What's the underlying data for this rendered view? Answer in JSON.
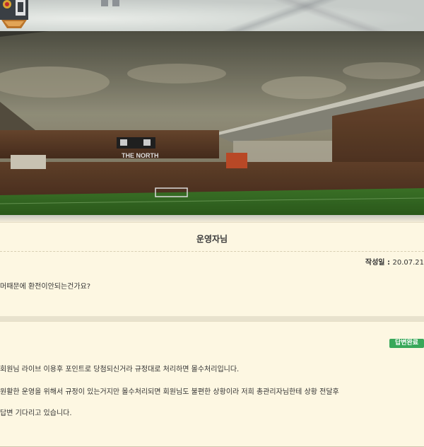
{
  "banner": {
    "board_text": "THE NORTH"
  },
  "question": {
    "title": "운영자님",
    "date_label": "작성일 : ",
    "date_value": "20.07.21",
    "body": "머때문에 환전이안되는건가요?"
  },
  "answer": {
    "badge": "답변완료",
    "lines": [
      "회원님 라이브 이용후 포인트로 당첨되신거라 규정대로 처리하면 몰수처리입니다.",
      "원활한 운영을 위해서 규정이 있는거지만 몰수처리되면 회원님도 불편한 상황이라 저희 총관리자님한테 상황 전달후",
      "답변 기다리고 있습니다."
    ]
  },
  "colors": {
    "background": "#f2ecd8",
    "panel": "#fdf7e2",
    "badge": "#39a85a"
  }
}
